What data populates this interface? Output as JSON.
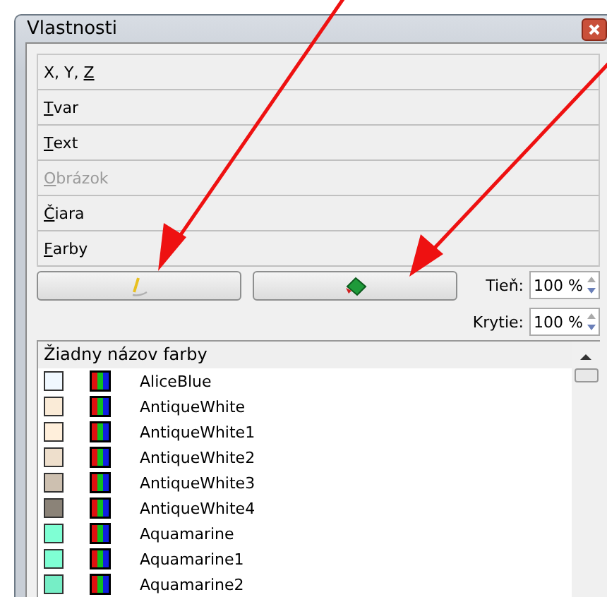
{
  "window": {
    "title": "Vlastnosti"
  },
  "sections": [
    {
      "before": "X, Y, ",
      "key": "Z",
      "disabled": false
    },
    {
      "key": "T",
      "after": "var",
      "disabled": false
    },
    {
      "key": "T",
      "after": "ext",
      "disabled": false
    },
    {
      "key": "O",
      "after": "brázok",
      "disabled": true
    },
    {
      "key": "Č",
      "after": "iara",
      "disabled": false
    },
    {
      "key": "F",
      "after": "arby",
      "disabled": false
    }
  ],
  "shadow": {
    "label": "Tieň:",
    "value": "100 %"
  },
  "opacity": {
    "label": "Krytie:",
    "value": "100 %"
  },
  "color_list": {
    "header": "Žiadny názov farby",
    "items": [
      {
        "name": "AliceBlue",
        "color": "#f0f8ff"
      },
      {
        "name": "AntiqueWhite",
        "color": "#faebd7"
      },
      {
        "name": "AntiqueWhite1",
        "color": "#ffefdb"
      },
      {
        "name": "AntiqueWhite2",
        "color": "#eedfcc"
      },
      {
        "name": "AntiqueWhite3",
        "color": "#cdc0b0"
      },
      {
        "name": "AntiqueWhite4",
        "color": "#8b8378"
      },
      {
        "name": "Aquamarine",
        "color": "#7fffd4"
      },
      {
        "name": "Aquamarine1",
        "color": "#7fffd4"
      },
      {
        "name": "Aquamarine2",
        "color": "#76eec6"
      }
    ]
  }
}
